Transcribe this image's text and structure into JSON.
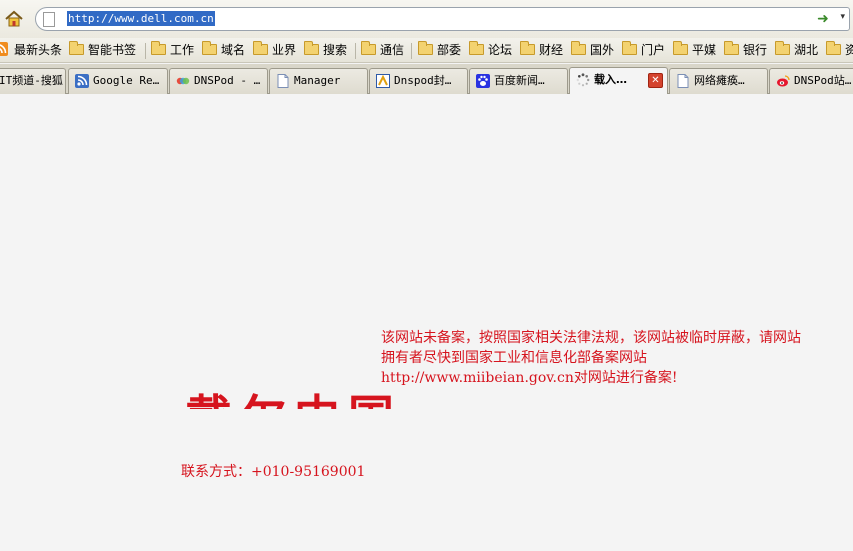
{
  "navbar": {
    "url": "http://www.dell.com.cn",
    "home_icon": "home-icon",
    "go_icon": "go-arrow-icon",
    "go_symbol": "➜",
    "dropdown_symbol": "▾"
  },
  "bookmarks": [
    {
      "label": "最新头条",
      "icon": "rss-icon"
    },
    {
      "label": "智能书签",
      "icon": "folder-icon"
    },
    {
      "label": "工作",
      "icon": "folder-icon"
    },
    {
      "label": "域名",
      "icon": "folder-icon"
    },
    {
      "label": "业界",
      "icon": "folder-icon"
    },
    {
      "label": "搜索",
      "icon": "folder-icon"
    },
    {
      "label": "通信",
      "icon": "folder-icon"
    },
    {
      "label": "部委",
      "icon": "folder-icon"
    },
    {
      "label": "论坛",
      "icon": "folder-icon"
    },
    {
      "label": "财经",
      "icon": "folder-icon"
    },
    {
      "label": "国外",
      "icon": "folder-icon"
    },
    {
      "label": "门户",
      "icon": "folder-icon"
    },
    {
      "label": "平媒",
      "icon": "folder-icon"
    },
    {
      "label": "银行",
      "icon": "folder-icon"
    },
    {
      "label": "湖北",
      "icon": "folder-icon"
    },
    {
      "label": "资",
      "icon": "folder-icon"
    }
  ],
  "tabs": [
    {
      "label": "IT频道-搜狐",
      "icon": "page-icon"
    },
    {
      "label": "Google Re…",
      "icon": "rss-icon"
    },
    {
      "label": "DNSPod - …",
      "icon": "dnspod-icon"
    },
    {
      "label": "Manager",
      "icon": "page-icon"
    },
    {
      "label": "Dnspod封…",
      "icon": "news-icon"
    },
    {
      "label": "百度新闻…",
      "icon": "baidu-paw-icon"
    },
    {
      "label": "载入…",
      "icon": "loading-spinner-icon",
      "active": true,
      "close_symbol": "✕"
    },
    {
      "label": "网络瘫痪…",
      "icon": "page-icon"
    },
    {
      "label": "DNSPod站…",
      "icon": "weibo-icon"
    }
  ],
  "content": {
    "notice": "该网站未备案，按照国家相关法律法规，该网站被临时屏蔽，请网站拥有者尽快到国家工业和信息化部备案网站http://www.miibeian.gov.cn对网站进行备案!",
    "title": "戴尔中国",
    "contact": "联系方式：+010-95169001"
  },
  "colors": {
    "notice_red": "#d6141e",
    "selection_blue": "#316ac5",
    "page_background": "#f4f4f4"
  }
}
